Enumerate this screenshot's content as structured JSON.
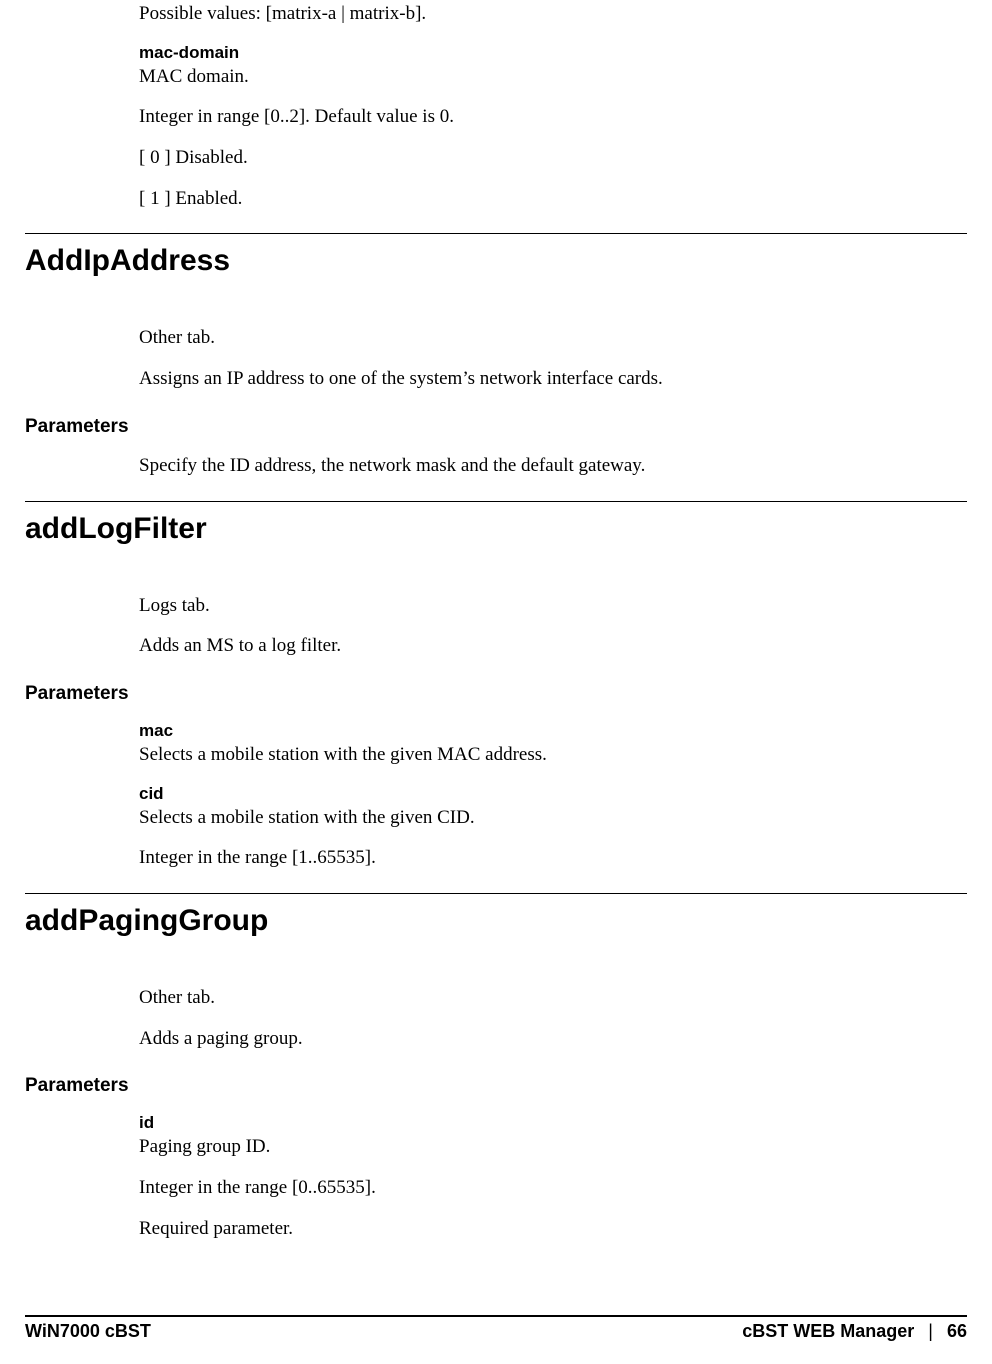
{
  "top_continuation": {
    "possible_values": "Possible values: [matrix-a | matrix-b].",
    "mac_domain_name": "mac-domain",
    "mac_domain_desc": "MAC domain.",
    "integer_range": "Integer in range [0..2]. Default value is 0.",
    "disabled": "[ 0 ] Disabled.",
    "enabled": "[ 1 ] Enabled."
  },
  "sections": {
    "addIpAddress": {
      "title": "AddIpAddress",
      "tab": "Other tab.",
      "description": "Assigns an IP address to one of the system’s network interface cards.",
      "parameters_label": "Parameters",
      "parameters_desc": "Specify the ID address, the network mask and the default gateway."
    },
    "addLogFilter": {
      "title": "addLogFilter",
      "tab": "Logs tab.",
      "description": "Adds an MS to a log filter.",
      "parameters_label": "Parameters",
      "params": {
        "mac_name": "mac",
        "mac_desc": "Selects a mobile station with the given MAC address.",
        "cid_name": "cid",
        "cid_desc": "Selects a mobile station with the given CID.",
        "cid_range": "Integer in the range [1..65535]."
      }
    },
    "addPagingGroup": {
      "title": "addPagingGroup",
      "tab": "Other tab.",
      "description": "Adds a paging group.",
      "parameters_label": "Parameters",
      "params": {
        "id_name": "id",
        "id_desc": "Paging group ID.",
        "id_range": "Integer in the range [0..65535].",
        "id_required": "Required parameter."
      }
    }
  },
  "footer": {
    "left": "WiN7000 cBST",
    "right": "cBST WEB Manager",
    "sep": "|",
    "page": "66"
  }
}
